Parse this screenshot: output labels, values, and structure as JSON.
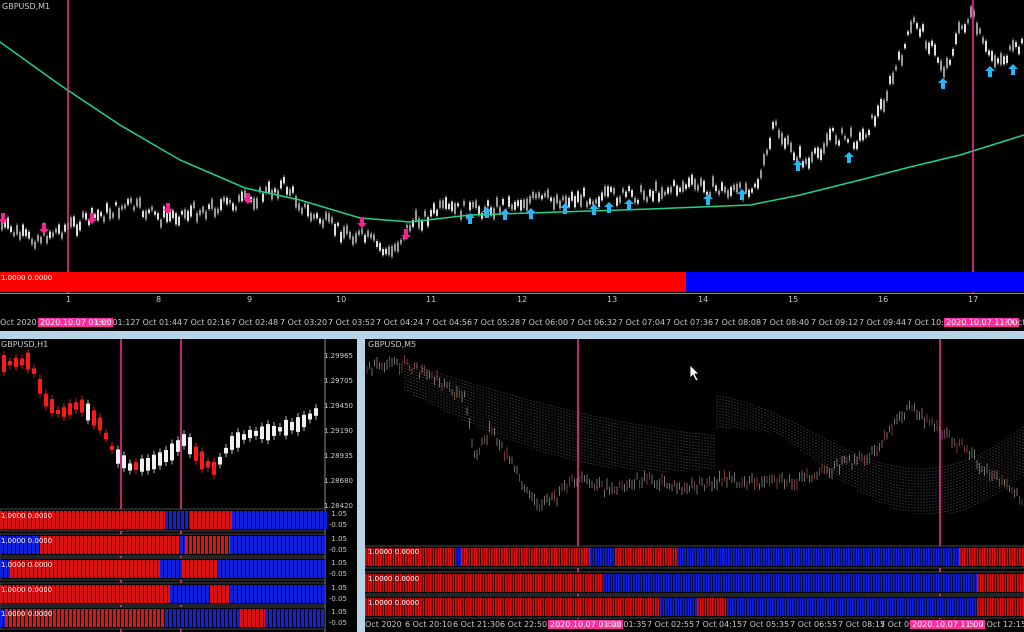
{
  "top_chart": {
    "symbol_label": "GBPUSD,M1",
    "indicator_text": "1.0000 0.0000",
    "day_labels": [
      "1",
      "8",
      "9",
      "10",
      "11",
      "12",
      "13",
      "14",
      "15",
      "16",
      "17"
    ],
    "time_labels": [
      "Oct 2020",
      "2020.10.07 01:00",
      "Oct 01:12",
      "7 Oct 01:44",
      "7 Oct 02:16",
      "7 Oct 02:48",
      "7 Oct 03:20",
      "7 Oct 03:52",
      "7 Oct 04:24",
      "7 Oct 04:56",
      "7 Oct 05:28",
      "7 Oct 06:00",
      "7 Oct 06:32",
      "7 Oct 07:04",
      "7 Oct 07:36",
      "7 Oct 08:08",
      "7 Oct 08:40",
      "7 Oct 09:12",
      "7 Oct 09:44",
      "7 Oct 10:16",
      "2020.10.07 11:00",
      "7 Oct 1"
    ],
    "colors": {
      "ma": "#1fd38a",
      "up_arrow": "#29b6f6",
      "down_arrow": "#ff1f8e",
      "vline": "#ff2d9b",
      "red": "#ff0000",
      "blue": "#0000ff"
    }
  },
  "bottom_left": {
    "symbol_label": "GBPUSD,H1",
    "prices": [
      "1.29965",
      "1.29705",
      "1.29450",
      "1.29190",
      "1.28935",
      "1.28680",
      "1.28420"
    ],
    "band_rows": [
      {
        "text": "1.0000 0.0000",
        "scale_top": "1.05",
        "scale_bot": "-0.05"
      },
      {
        "text": "1.0000 0.0000",
        "scale_top": "1.05",
        "scale_bot": "-0.05"
      },
      {
        "text": "1.0000 0.0000",
        "scale_top": "1.05",
        "scale_bot": "-0.05"
      },
      {
        "text": "1.0000 0.0000",
        "scale_top": "1.05",
        "scale_bot": "-0.05"
      },
      {
        "text": "1.0000 0.0000",
        "scale_top": "1.05",
        "scale_bot": "-0.05"
      }
    ]
  },
  "bottom_right": {
    "symbol_label": "GBPUSD,M5",
    "band_rows": [
      {
        "text": "1.0000 0.0000"
      },
      {
        "text": "1.0000 0.0000"
      },
      {
        "text": "1.0000 0.0000"
      }
    ],
    "time_labels": [
      "Oct 2020",
      "6 Oct 20:10",
      "6 Oct 21:30",
      "6 Oct 22:50",
      "2020.10.07 01:00",
      "Oct 01:35",
      "7 Oct 02:55",
      "7 Oct 04:15",
      "7 Oct 05:35",
      "7 Oct 06:55",
      "7 Oct 08:15",
      "7 Oct 09:35",
      "2020.10.07 11:00",
      "5",
      "7 Oct 12:15"
    ]
  }
}
